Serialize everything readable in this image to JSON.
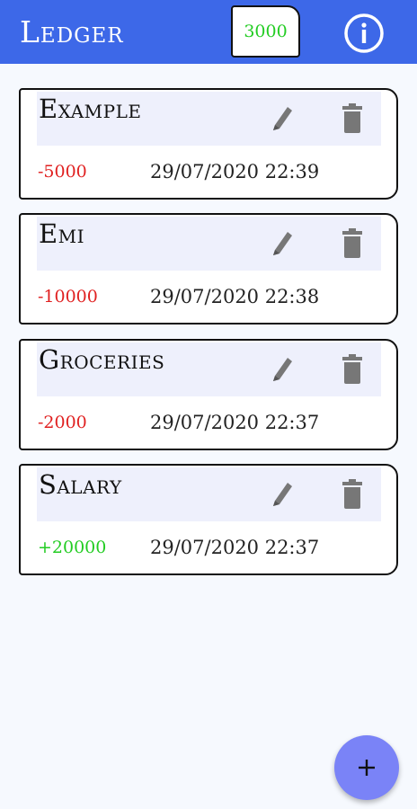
{
  "app": {
    "title": "Ledger",
    "balance": "3000"
  },
  "colors": {
    "appbar": "#3d68e8",
    "negative": "#e02020",
    "positive": "#22cc22",
    "fab": "#7a83f7"
  },
  "icons": {
    "info": "info-icon",
    "edit": "pencil-icon",
    "delete": "trash-icon",
    "add": "plus-icon"
  },
  "entries": [
    {
      "title": "Example",
      "amount": "-5000",
      "type": "negative",
      "timestamp": "29/07/2020 22:39"
    },
    {
      "title": "Emi",
      "amount": "-10000",
      "type": "negative",
      "timestamp": "29/07/2020 22:38"
    },
    {
      "title": "Groceries",
      "amount": "-2000",
      "type": "negative",
      "timestamp": "29/07/2020 22:37"
    },
    {
      "title": "Salary",
      "amount": "+20000",
      "type": "positive",
      "timestamp": "29/07/2020 22:37"
    }
  ],
  "fab": {
    "label": "+"
  }
}
